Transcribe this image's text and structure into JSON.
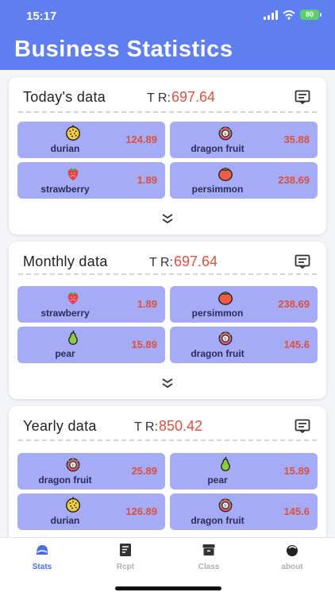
{
  "status": {
    "time": "15:17",
    "battery": "80"
  },
  "header": {
    "title": "Business Statistics"
  },
  "cards": [
    {
      "title": "Today's data",
      "tr_label": "T R:",
      "tr_value": "697.64",
      "items": [
        {
          "name": "durian",
          "value": "124.89",
          "icon": "durian-icon"
        },
        {
          "name": "dragon fruit",
          "value": "35.88",
          "icon": "dragon-fruit-icon"
        },
        {
          "name": "strawberry",
          "value": "1.89",
          "icon": "strawberry-icon"
        },
        {
          "name": "persimmon",
          "value": "238.69",
          "icon": "persimmon-icon"
        }
      ]
    },
    {
      "title": "Monthly data",
      "tr_label": "T R:",
      "tr_value": "697.64",
      "items": [
        {
          "name": "strawberry",
          "value": "1.89",
          "icon": "strawberry-icon"
        },
        {
          "name": "persimmon",
          "value": "238.69",
          "icon": "persimmon-icon"
        },
        {
          "name": "pear",
          "value": "15.89",
          "icon": "pear-icon"
        },
        {
          "name": "dragon fruit",
          "value": "145.6",
          "icon": "dragon-fruit-icon"
        }
      ]
    },
    {
      "title": "Yearly data",
      "tr_label": "T R:",
      "tr_value": "850.42",
      "items": [
        {
          "name": "dragon fruit",
          "value": "25.89",
          "icon": "dragon-fruit-icon"
        },
        {
          "name": "pear",
          "value": "15.89",
          "icon": "pear-icon"
        },
        {
          "name": "durian",
          "value": "126.89",
          "icon": "durian-icon"
        },
        {
          "name": "dragon fruit",
          "value": "145.6",
          "icon": "dragon-fruit-icon"
        }
      ]
    }
  ],
  "tabs": [
    {
      "label": "Stats",
      "icon": "stats-icon",
      "active": true
    },
    {
      "label": "Rcpt",
      "icon": "receipt-icon"
    },
    {
      "label": "Class",
      "icon": "box-icon"
    },
    {
      "label": "about",
      "icon": "about-icon"
    }
  ],
  "colors": {
    "header": "#5f7ef0",
    "tile": "#a5abf5",
    "value": "#e0503c",
    "active_tab": "#4a6fe3"
  }
}
